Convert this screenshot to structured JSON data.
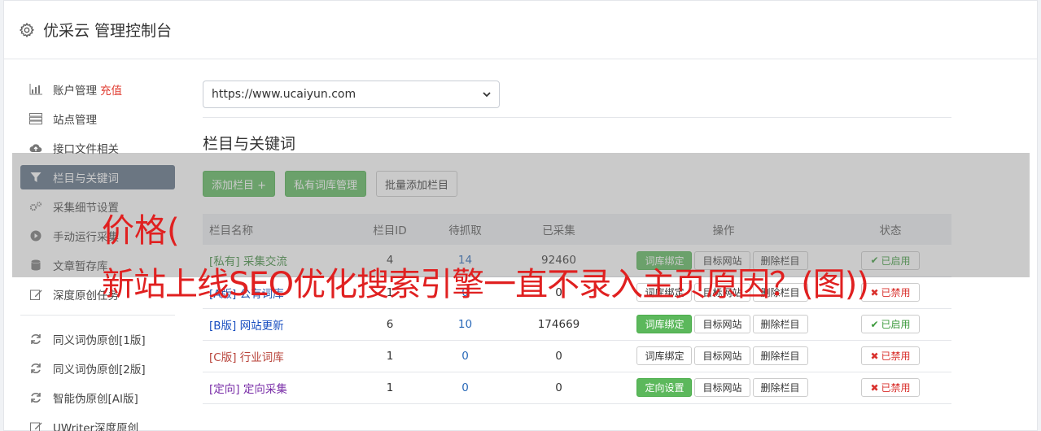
{
  "header": {
    "title": "优采云 管理控制台"
  },
  "sidebar": {
    "items": [
      {
        "label": "账户管理",
        "extra": "充值",
        "icon": "bar-chart-icon"
      },
      {
        "label": "站点管理",
        "icon": "server-icon"
      },
      {
        "label": "接口文件相关",
        "icon": "cloud-upload-icon"
      },
      {
        "label": "栏目与关键词",
        "icon": "filter-icon",
        "active": true
      },
      {
        "label": "采集细节设置",
        "icon": "cogs-icon"
      },
      {
        "label": "手动运行采集",
        "icon": "play-circle-icon"
      },
      {
        "label": "文章暂存库",
        "icon": "database-icon"
      },
      {
        "label": "深度原创任务",
        "icon": "edit-icon"
      }
    ],
    "items2": [
      {
        "label": "同义词伪原创[1版]",
        "icon": "refresh-icon"
      },
      {
        "label": "同义词伪原创[2版]",
        "icon": "refresh-icon"
      },
      {
        "label": "智能伪原创[AI版]",
        "icon": "refresh-icon"
      },
      {
        "label": "UWriter深度原创",
        "icon": "edit-icon"
      }
    ]
  },
  "main": {
    "site_select": "https://www.ucaiyun.com",
    "section_title": "栏目与关键词",
    "buttons": {
      "add": "添加栏目 +",
      "private": "私有词库管理",
      "batch": "批量添加栏目"
    },
    "table": {
      "headers": [
        "栏目名称",
        "栏目ID",
        "待抓取",
        "已采集",
        "操作",
        "状态"
      ],
      "rows": [
        {
          "tag": "[私有]",
          "name": "采集交流",
          "id": "4",
          "pending": "14",
          "collected": "92460",
          "btn1": "词库绑定",
          "btn2": "目标网站",
          "btn3": "删除栏目",
          "status": "已启用",
          "on": true,
          "color": "#3c8a3c"
        },
        {
          "tag": "[A版]",
          "name": "公有词库",
          "id": "1",
          "pending": "0",
          "collected": "0",
          "btn1": "词库绑定",
          "btn2": "目标网站",
          "btn3": "删除栏目",
          "status": "已禁用",
          "on": false,
          "color": "#2255aa"
        },
        {
          "tag": "[B版]",
          "name": "网站更新",
          "id": "6",
          "pending": "10",
          "collected": "174669",
          "btn1": "词库绑定",
          "btn2": "目标网站",
          "btn3": "删除栏目",
          "status": "已启用",
          "on": true,
          "color": "#1a4fc0"
        },
        {
          "tag": "[C版]",
          "name": "行业词库",
          "id": "1",
          "pending": "0",
          "collected": "0",
          "btn1": "词库绑定",
          "btn2": "目标网站",
          "btn3": "删除栏目",
          "status": "已禁用",
          "on": false,
          "color": "#b8433a"
        },
        {
          "tag": "[定向]",
          "name": "定向采集",
          "id": "1",
          "pending": "0",
          "collected": "0",
          "btn1": "定向设置",
          "btn2": "目标网站",
          "btn3": "删除栏目",
          "status": "已禁用",
          "on": false,
          "color": "#7a2fa8"
        }
      ]
    }
  },
  "overlay": {
    "line1": "价格(",
    "line2": "新站上线SEO优化搜索引擎一直不录入主页原因？(图))"
  },
  "colors": {
    "accent_green": "#5cb85c",
    "active_nav": "#5c6e84",
    "overlay_text": "#e02020"
  }
}
